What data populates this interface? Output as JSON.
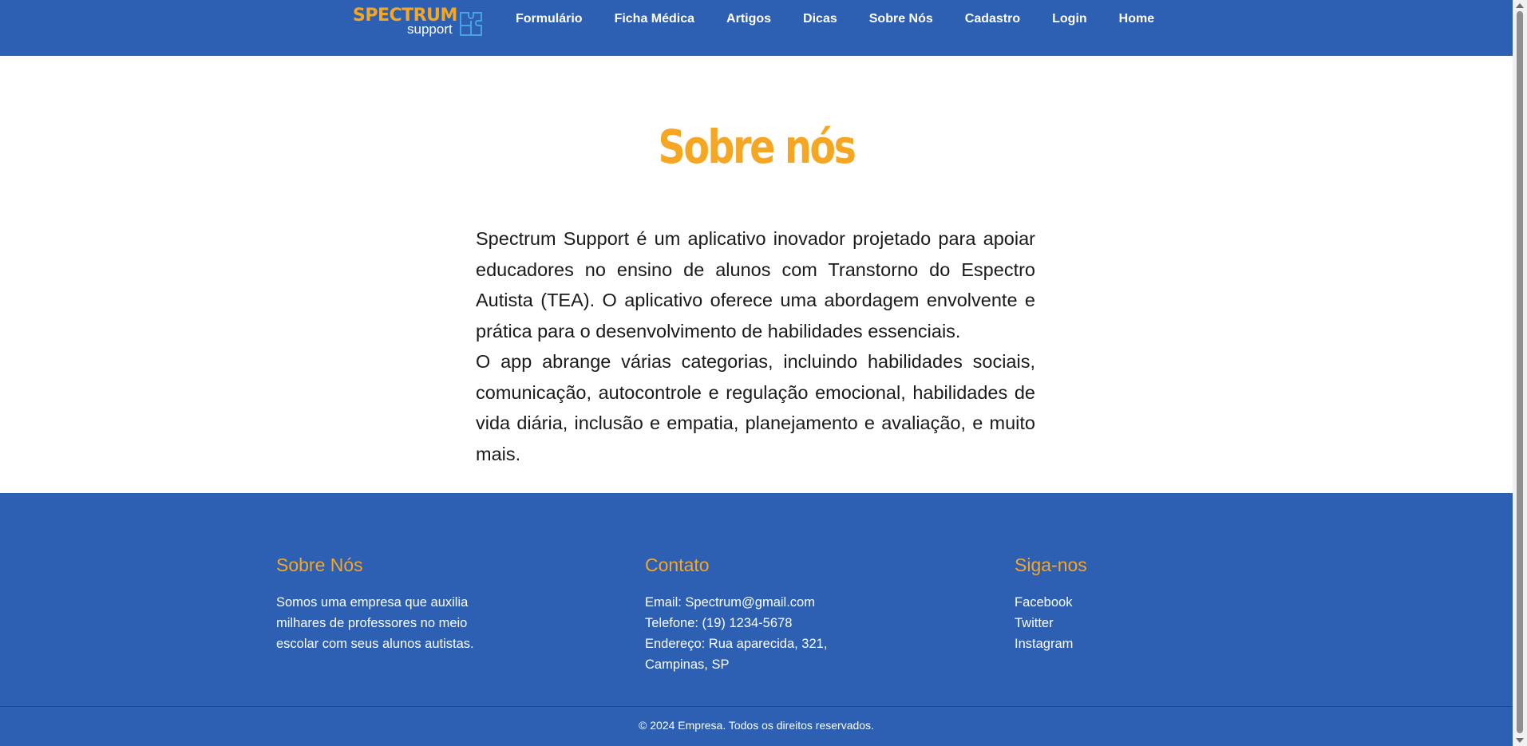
{
  "header": {
    "logo": {
      "title": "SPECTRUM",
      "subtitle": "support",
      "icon": "puzzle-icon"
    },
    "nav": [
      {
        "label": "Formulário"
      },
      {
        "label": "Ficha Médica"
      },
      {
        "label": "Artigos"
      },
      {
        "label": "Dicas"
      },
      {
        "label": "Sobre Nós"
      },
      {
        "label": "Cadastro"
      },
      {
        "label": "Login"
      },
      {
        "label": "Home"
      }
    ]
  },
  "main": {
    "title": "Sobre nós",
    "paragraphs": [
      "Spectrum Support é um aplicativo inovador projetado para apoiar educadores no ensino de alunos com Transtorno do Espectro Autista (TEA). O aplicativo oferece uma abordagem envolvente e prática para o desenvolvimento de habilidades essenciais.",
      "O app abrange várias categorias, incluindo habilidades sociais, comunicação, autocontrole e regulação emocional, habilidades de vida diária, inclusão e empatia, planejamento e avaliação, e muito mais."
    ]
  },
  "footer": {
    "about": {
      "heading": "Sobre Nós",
      "lines": [
        "Somos uma empresa que auxilia",
        "milhares de professores no meio",
        "escolar com seus alunos autistas."
      ]
    },
    "contact": {
      "heading": "Contato",
      "email": "Email: Spectrum@gmail.com",
      "phone": "Telefone: (19) 1234-5678",
      "address_line1": "Endereço: Rua aparecida, 321,",
      "address_line2": "Campinas, SP"
    },
    "social": {
      "heading": "Siga-nos",
      "links": [
        "Facebook",
        "Twitter",
        "Instagram"
      ]
    },
    "copyright": "© 2024 Empresa. Todos os direitos reservados."
  },
  "colors": {
    "primary": "#2d5fb3",
    "accent": "#f5a623",
    "text": "#1a1a1a"
  }
}
